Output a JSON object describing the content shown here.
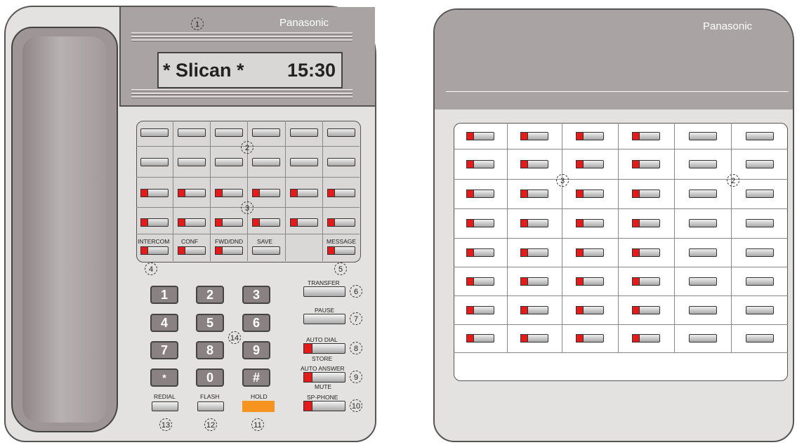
{
  "phone": {
    "brand": "Panasonic",
    "display": {
      "left_text": "* Slican *",
      "time": "15:30"
    },
    "feature_keys": [
      "INTERCOM",
      "CONF",
      "FWD/DND",
      "SAVE",
      "",
      "MESSAGE"
    ],
    "dialpad": [
      "1",
      "2",
      "3",
      "4",
      "5",
      "6",
      "7",
      "8",
      "9",
      "*",
      "0",
      "#"
    ],
    "side_keys": [
      {
        "top": "TRANSFER",
        "bottom": "",
        "callout": "6"
      },
      {
        "top": "PAUSE",
        "bottom": "",
        "callout": "7"
      },
      {
        "top": "AUTO DIAL",
        "bottom": "STORE",
        "callout": "8"
      },
      {
        "top": "AUTO ANSWER",
        "bottom": "MUTE",
        "callout": "9"
      },
      {
        "top": "SP-PHONE",
        "bottom": "",
        "callout": "10"
      }
    ],
    "bottom_keys": [
      {
        "label": "REDIAL",
        "callout": "13"
      },
      {
        "label": "FLASH",
        "callout": "12"
      },
      {
        "label": "HOLD",
        "callout": "11"
      }
    ],
    "callouts": {
      "c1": "1",
      "c2": "2",
      "c3": "3",
      "c4": "4",
      "c5": "5",
      "c14": "14"
    },
    "colors": {
      "body": "#e4e1e1",
      "panel": "#a9a3a3",
      "led": "#e41b1b",
      "hold": "#f79420"
    }
  },
  "console": {
    "brand": "Panasonic",
    "callouts": {
      "c3": "3",
      "c2": "2"
    }
  }
}
